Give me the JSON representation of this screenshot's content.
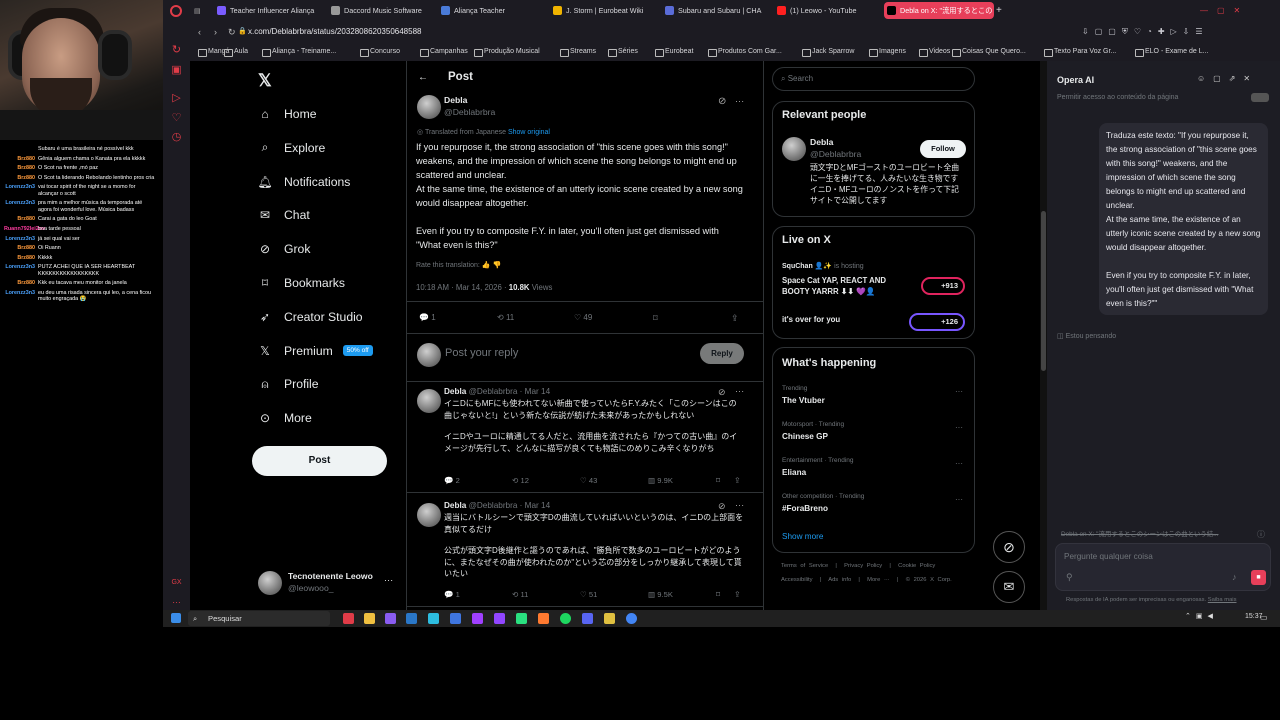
{
  "chat": [
    {
      "user": "",
      "msg": "Subaru é uma brasileira né possível kkk",
      "color": "#ff9a3c"
    },
    {
      "user": "Brz880",
      "msg": "Gênia alguem chama o Kanata pra ela kkkkk",
      "color": "#ff9a3c"
    },
    {
      "user": "Brz880",
      "msg": "O Scot na frente ,mó paz",
      "color": "#ff9a3c"
    },
    {
      "user": "Brz880",
      "msg": "O Scot ta liderando Rebolando lentinho pros cria",
      "color": "#ff9a3c"
    },
    {
      "user": "Lorenzz3n3",
      "msg": "vai tocar spirit of the night se a momo for alcançar o scott",
      "color": "#4ba3ff"
    },
    {
      "user": "Lorenzz3n3",
      "msg": "pra mim a melhor música da temporada até agora foi wonderful love. Música badass",
      "color": "#4ba3ff"
    },
    {
      "user": "Brz880",
      "msg": "Carai a gata do leo Goat",
      "color": "#ff9a3c"
    },
    {
      "user": "Ruann792lei2ov",
      "msg": "boa tarde pessoal",
      "color": "#ff3ca0"
    },
    {
      "user": "Lorenzz3n3",
      "msg": "já sei qual vai ser",
      "color": "#4ba3ff"
    },
    {
      "user": "Brz880",
      "msg": "Oi Ruann",
      "color": "#ff9a3c"
    },
    {
      "user": "Brz880",
      "msg": "Kkkkk",
      "color": "#ff9a3c"
    },
    {
      "user": "Lorenzz3n3",
      "msg": "PUTZ ACHEI QUE IA SER HEARTBEAT KKKKKKKKKKKKKKKKK",
      "color": "#4ba3ff"
    },
    {
      "user": "Brz880",
      "msg": "Kkk eu tacava meu monitor da janela",
      "color": "#ff9a3c"
    },
    {
      "user": "Lorenzz3n3",
      "msg": "eu deu uma risada sincera qui leo, a cena ficou muito engraçada 😭",
      "color": "#4ba3ff"
    }
  ],
  "tabs": [
    {
      "label": "Teacher Influencer Aliança",
      "color": "#7a5cff"
    },
    {
      "label": "Daccord Music Software",
      "color": "#999"
    },
    {
      "label": "Aliança Teacher",
      "color": "#4a7bd8"
    },
    {
      "label": "J. Storm | Eurobeat Wiki",
      "color": "#f0b400"
    },
    {
      "label": "Subaru and Subaru | CHA",
      "color": "#5a6cd8"
    },
    {
      "label": "(1) Leowo - YouTube",
      "color": "#ff2020"
    },
    {
      "label": "Debla on X: \"流用するとこの",
      "color": "#000"
    }
  ],
  "address": {
    "url": "x.com/Deblabrbra/status/2032808620350648588"
  },
  "bookmarks": [
    "Mangá",
    "Aula",
    "Aliança - Treiname...",
    "Concurso",
    "Campanhas",
    "Produção Musical",
    "Streams",
    "Séries",
    "Eurobeat",
    "Produtos Com Gar...",
    "Jack Sparrow",
    "Imagens",
    "Videos",
    "Coisas Que Quero...",
    "Texto Para Voz Gr...",
    "ELO - Exame de L..."
  ],
  "nav": {
    "items": [
      {
        "label": "Home",
        "icon": "home-icon"
      },
      {
        "label": "Explore",
        "icon": "search-icon"
      },
      {
        "label": "Notifications",
        "icon": "bell-icon"
      },
      {
        "label": "Chat",
        "icon": "mail-icon"
      },
      {
        "label": "Grok",
        "icon": "grok-icon"
      },
      {
        "label": "Bookmarks",
        "icon": "bookmark-icon"
      },
      {
        "label": "Creator Studio",
        "icon": "rocket-icon"
      },
      {
        "label": "Premium",
        "icon": "x-icon"
      },
      {
        "label": "Profile",
        "icon": "person-icon"
      },
      {
        "label": "More",
        "icon": "more-icon"
      }
    ],
    "premium_badge": "50% off",
    "post_label": "Post",
    "account_name": "Tecnotenente Leowo",
    "account_handle": "@leowooo_"
  },
  "post": {
    "header": "Post",
    "author": "Debla",
    "handle": "@Deblabrbra",
    "translated_note": "Translated from Japanese",
    "show_original": "Show original",
    "text1": "If you repurpose it, the strong association of \"this scene goes with this song!\" weakens, and the impression of which scene the song belongs to might end up scattered and unclear.",
    "text2": "At the same time, the existence of an utterly iconic scene created by a new song would disappear altogether.",
    "text3": "Even if you try to composite F.Y. in later, you'll often just get dismissed with \"What even is this?\"",
    "rate": "Rate this translation:",
    "time": "10:18 AM · Mar 14, 2026 ·",
    "views_count": "10.8K",
    "views_label": "Views",
    "replies": "1",
    "reposts": "11",
    "likes": "49",
    "reply_placeholder": "Post your reply",
    "reply_button": "Reply"
  },
  "replies": [
    {
      "author": "Debla",
      "handle": "@Deblabrbra · Mar 14",
      "text1": "イニDにもMFにも使われてない新曲で使っていたらF.Y.みたく「このシーンはこの曲じゃないと!」という新たな伝説が紡げた未来があったかもしれない",
      "text2": "イニDやユーロに精通してる人だと、流用曲を流されたら『かつての古い曲』のイメージが先行して、どんなに描写が良くても物語にのめりこみ辛くなりがち",
      "r": "2",
      "rt": "12",
      "l": "43",
      "v": "9.9K"
    },
    {
      "author": "Debla",
      "handle": "@Deblabrbra · Mar 14",
      "text1": "週当にバトルシーンで頭文字Dの曲流していればいいというのは、イニDの上部面を真似てるだけ",
      "text2": "公式が頭文字D後継作と謳うのであれば、\"勝負所で数多のユーロビートがどのように、またなぜその曲が使われたのか\"という芯の部分をしっかり継承して表現して貰いたい",
      "r": "1",
      "rt": "11",
      "l": "51",
      "v": "9.5K"
    }
  ],
  "right": {
    "search_placeholder": "Search",
    "relevant_title": "Relevant people",
    "person_name": "Debla",
    "person_handle": "@Deblabrbra",
    "person_bio": "頭文字DとMFゴーストのユーロビート全曲に一生を捧げてる、人みたいな生き物です イニD・MFユーロのノンストを作って下記サイトで公開してます",
    "follow": "Follow",
    "live_title": "Live on X",
    "live_host": "SquChan 👤✨",
    "live_hosting": "is hosting",
    "live1_title": "Space Cat YAP, REACT AND BOOTY YARRR ⬇⬇ 💜👤",
    "live1_count": "+913",
    "live2_title": "it's over for you",
    "live2_count": "+126",
    "happening_title": "What's happening",
    "trends": [
      {
        "cat": "Trending",
        "name": "The Vtuber"
      },
      {
        "cat": "Motorsport · Trending",
        "name": "Chinese GP"
      },
      {
        "cat": "Entertainment · Trending",
        "name": "Eliana"
      },
      {
        "cat": "Other competition · Trending",
        "name": "#ForaBreno"
      }
    ],
    "show_more": "Show more",
    "footer1": [
      "Terms of Service",
      "Privacy Policy",
      "Cookie Policy"
    ],
    "footer2": [
      "Accessibility",
      "Ads info",
      "More ···",
      "© 2026 X Corp."
    ]
  },
  "ai": {
    "title": "Opera AI",
    "permission": "Permitir acesso ao conteúdo da página",
    "bubble": "Traduza este texto: \"If you repurpose it, the strong association of \"this scene goes with this song!\" weakens, and the impression of which scene the song belongs to might end up scattered and unclear.\nAt the same time, the existence of an utterly iconic scene created by a new song would disappear altogether.\n\nEven if you try to composite F.Y. in later, you'll often just get dismissed with \"What even is this?\"\"",
    "thinking": "Estou pensando",
    "context_tab": "Debla on X: \"流用するとこのシーンはこの曲という結...",
    "placeholder": "Pergunte qualquer coisa",
    "disclaimer": "Respostas de IA podem ser imprecisas ou enganosas.",
    "learn": "Saiba mais"
  },
  "taskbar": {
    "search": "Pesquisar",
    "time": "15:37"
  }
}
